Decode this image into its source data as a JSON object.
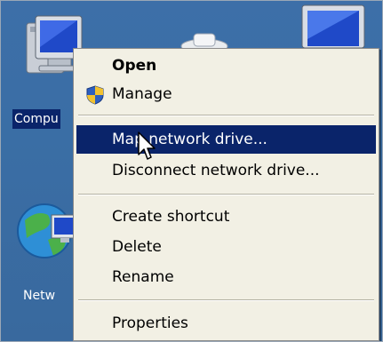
{
  "desktop": {
    "icons": [
      {
        "label": "Compu",
        "icon": "computer-icon",
        "selected": true
      },
      {
        "label": "Netw",
        "icon": "network-icon",
        "selected": false
      },
      {
        "label": "",
        "icon": "monitor-icon",
        "selected": false
      },
      {
        "label": "",
        "icon": "desktop-item-icon",
        "selected": false
      }
    ]
  },
  "menu": {
    "items": [
      {
        "label": "Open",
        "bold": true
      },
      {
        "label": "Manage",
        "icon": "uac-shield-icon"
      },
      {
        "label": "Map network drive...",
        "highlighted": true
      },
      {
        "label": "Disconnect network drive..."
      },
      {
        "label": "Create shortcut"
      },
      {
        "label": "Delete"
      },
      {
        "label": "Rename"
      },
      {
        "label": "Properties"
      }
    ]
  },
  "colors": {
    "desktop": "#3a6ea5",
    "menu_bg": "#f2f0e4",
    "highlight": "#0a246a",
    "highlight_text": "#ffffff"
  },
  "cursor": {
    "icon": "arrow-cursor-icon"
  }
}
